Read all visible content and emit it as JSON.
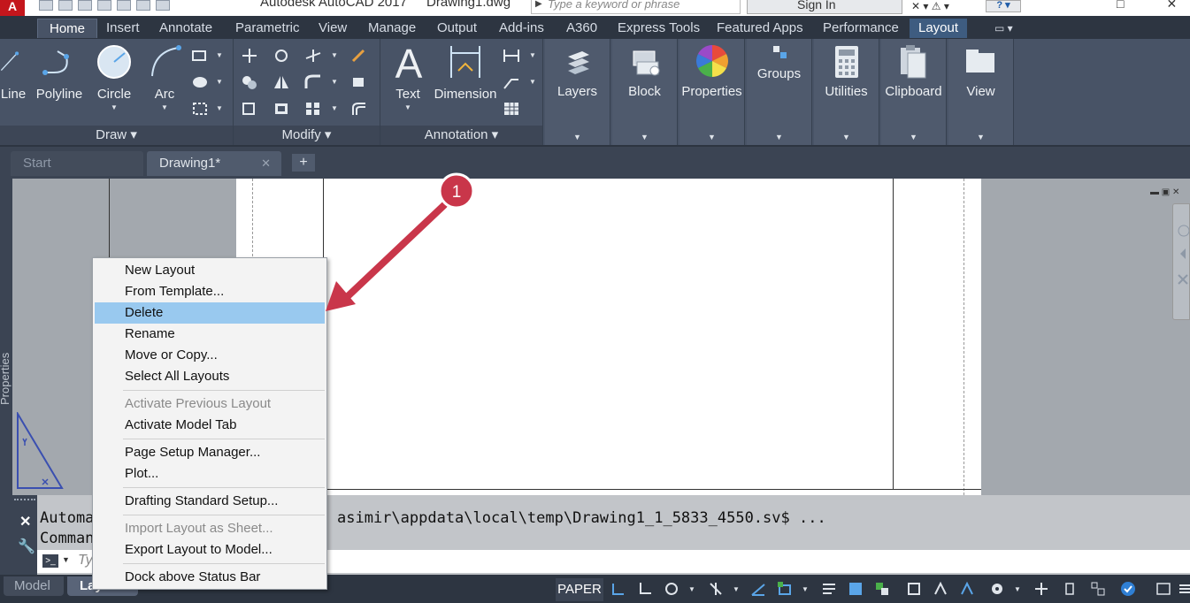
{
  "window": {
    "app_title": "Autodesk AutoCAD 2017",
    "doc_title": "Drawing1.dwg",
    "search_placeholder": "Type a keyword or phrase",
    "sign_in": "Sign In",
    "logo": "A"
  },
  "ribbon_tabs": [
    "Home",
    "Insert",
    "Annotate",
    "Parametric",
    "View",
    "Manage",
    "Output",
    "Add-ins",
    "A360",
    "Express Tools",
    "Featured Apps",
    "Performance",
    "Layout"
  ],
  "ribbon": {
    "draw": {
      "title": "Draw",
      "tools": [
        "Line",
        "Polyline",
        "Circle",
        "Arc"
      ]
    },
    "modify": {
      "title": "Modify"
    },
    "annotation": {
      "title": "Annotation",
      "tools": [
        "Text",
        "Dimension"
      ]
    },
    "tall_tools": [
      "Layers",
      "Block",
      "Properties",
      "Groups",
      "Utilities",
      "Clipboard",
      "View"
    ]
  },
  "file_tabs": {
    "start": "Start",
    "drawing": "Drawing1*",
    "close_glyph": "✕",
    "new_tab_glyph": "+"
  },
  "side_panel_label": "Properties",
  "command_line": {
    "line1_prefix": "Automa",
    "line1_path": "asimir\\appdata\\local\\temp\\Drawing1_1_5833_4550.sv$ ...",
    "line2_prefix": "Comman",
    "input_placeholder": "Ty",
    "prompt_glyph": ">_"
  },
  "layout_tabs": {
    "model": "Model",
    "layout": "Lay"
  },
  "status_bar": {
    "paper": "PAPER"
  },
  "context_menu": {
    "groups": [
      [
        {
          "label": "New Layout",
          "state": "normal"
        },
        {
          "label": "From Template...",
          "state": "normal"
        },
        {
          "label": "Delete",
          "state": "highlighted"
        },
        {
          "label": "Rename",
          "state": "normal"
        },
        {
          "label": "Move or Copy...",
          "state": "normal"
        },
        {
          "label": "Select All Layouts",
          "state": "normal"
        }
      ],
      [
        {
          "label": "Activate Previous Layout",
          "state": "disabled"
        },
        {
          "label": "Activate Model Tab",
          "state": "normal"
        }
      ],
      [
        {
          "label": "Page Setup Manager...",
          "state": "normal"
        },
        {
          "label": "Plot...",
          "state": "normal"
        }
      ],
      [
        {
          "label": "Drafting Standard Setup...",
          "state": "normal"
        }
      ],
      [
        {
          "label": "Import Layout as Sheet...",
          "state": "disabled"
        },
        {
          "label": "Export Layout to Model...",
          "state": "normal"
        }
      ],
      [
        {
          "label": "Dock above Status Bar",
          "state": "normal"
        }
      ]
    ]
  },
  "annotation": {
    "step_number": "1",
    "color": "#c9364a"
  },
  "colors": {
    "ribbon_bg": "#485366",
    "dark_bg": "#2d3541",
    "menu_highlight": "#99c9ef",
    "paper": "#ffffff"
  }
}
